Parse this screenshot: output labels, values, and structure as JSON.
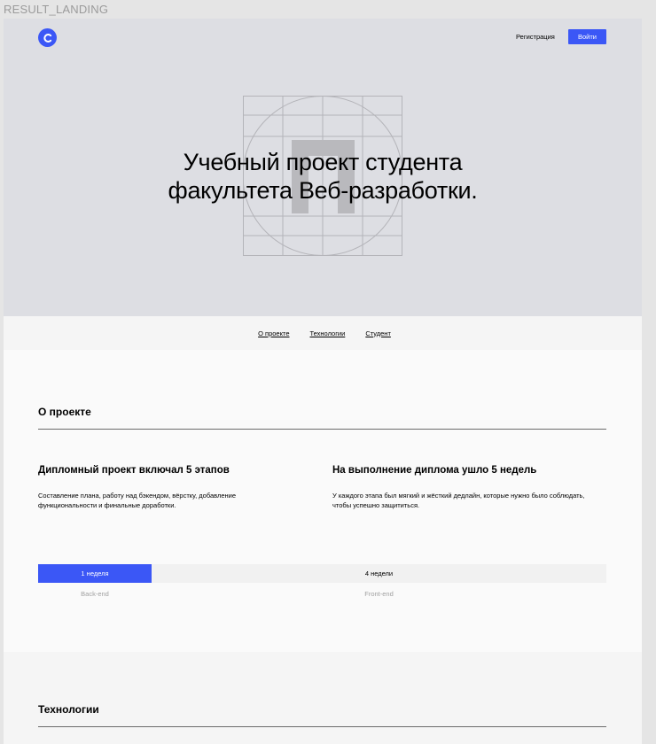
{
  "frame_label": "RESULT_LANDING",
  "header": {
    "logo_icon": "circle-c-logo",
    "register_label": "Регистрация",
    "login_label": "Войти"
  },
  "hero": {
    "title_line1": "Учебный проект студента",
    "title_line2": "факультета Веб-разработки."
  },
  "anchor_menu": {
    "items": [
      {
        "label": "О проекте"
      },
      {
        "label": "Технологии"
      },
      {
        "label": "Студент"
      }
    ]
  },
  "about": {
    "title": "О проекте",
    "columns": [
      {
        "title": "Дипломный проект включал 5 этапов",
        "text": "Составление плана, работу над бэкендом, вёрстку, добавление функциональности и финальные доработки."
      },
      {
        "title": "На выполнение диплома ушло 5 недель",
        "text": "У каждого этапа был мягкий и жёсткий дедлайн, которые нужно было соблюдать, чтобы успешно защититься."
      }
    ],
    "timeline": {
      "backend_bar": "1 неделя",
      "frontend_bar": "4 недели",
      "backend_label": "Back-end",
      "frontend_label": "Front-end"
    }
  },
  "tech": {
    "title": "Технологии"
  },
  "colors": {
    "accent": "#3b57f6",
    "hero_bg": "#dddee3",
    "page_bg": "#fafafa"
  }
}
